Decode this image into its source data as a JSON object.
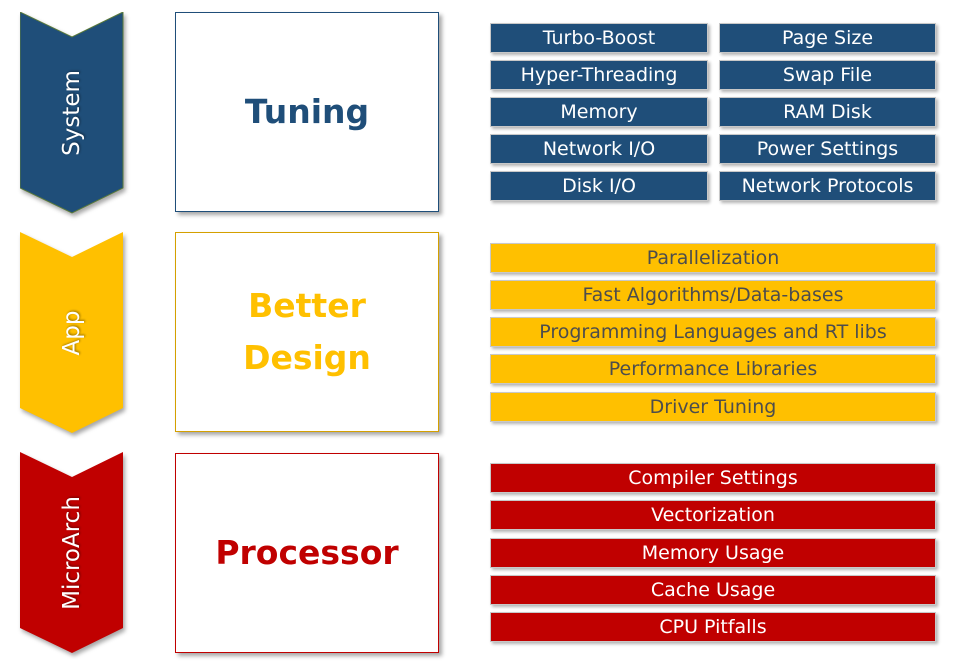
{
  "colors": {
    "system": "#1F4E79",
    "app": "#FFC000",
    "microarch": "#C00000"
  },
  "rows": [
    {
      "chevron": "System",
      "box_lines": [
        "Tuning"
      ],
      "items_left": [
        "Turbo-Boost",
        "Hyper-Threading",
        "Memory",
        "Network I/O",
        "Disk I/O"
      ],
      "items_right": [
        "Page Size",
        "Swap File",
        "RAM Disk",
        "Power Settings",
        "Network Protocols"
      ]
    },
    {
      "chevron": "App",
      "box_lines": [
        "Better",
        "Design"
      ],
      "items": [
        "Parallelization",
        "Fast Algorithms/Data-bases",
        "Programming Languages and RT libs",
        "Performance Libraries",
        "Driver Tuning"
      ]
    },
    {
      "chevron": "MicroArch",
      "box_lines": [
        "Processor"
      ],
      "items": [
        "Compiler Settings",
        "Vectorization",
        "Memory Usage",
        "Cache Usage",
        "CPU Pitfalls"
      ]
    }
  ]
}
